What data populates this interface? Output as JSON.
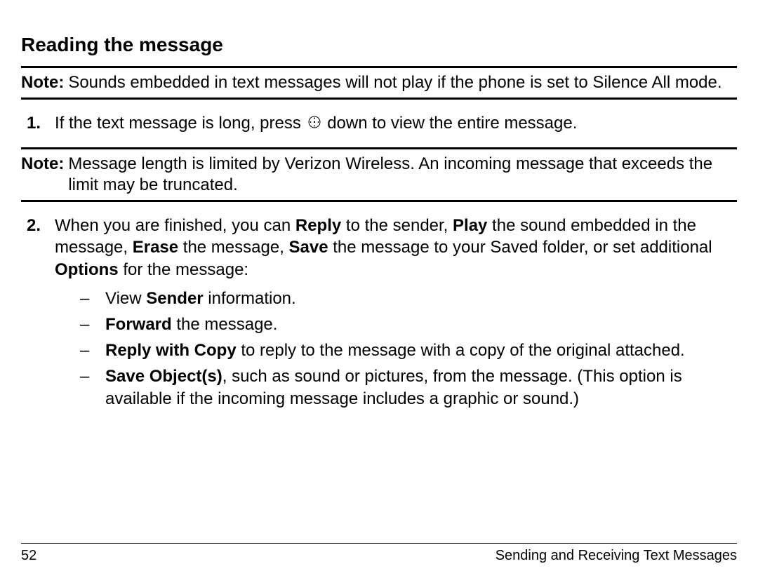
{
  "title": "Reading the message",
  "note1": {
    "label": "Note:",
    "text": "Sounds embedded in text messages will not play if the phone is set to Silence All mode."
  },
  "step1": {
    "num": "1.",
    "part1": "If the text message is long, press ",
    "part2": " down to view the entire message."
  },
  "note2": {
    "label": "Note:",
    "text": "Message length is limited by Verizon Wireless. An incoming message that exceeds the limit may be truncated."
  },
  "step2": {
    "num": "2.",
    "t1": "When you are finished, you can ",
    "b1": "Reply",
    "t2": " to the sender, ",
    "b2": "Play",
    "t3": " the sound embedded in the message, ",
    "b3": "Erase",
    "t4": " the message, ",
    "b4": "Save",
    "t5": " the message to your Saved folder, or set additional ",
    "b5": "Options",
    "t6": " for the message:"
  },
  "bullets": {
    "dash": "–",
    "a": {
      "t1": "View ",
      "b1": "Sender",
      "t2": " information."
    },
    "b": {
      "b1": "Forward",
      "t1": " the message."
    },
    "c": {
      "b1": "Reply with Copy",
      "t1": " to reply to the message with a copy of the original attached."
    },
    "d": {
      "b1": "Save Object(s)",
      "t1": ", such as sound or pictures, from the message. (This option is available if the incoming message includes a graphic or sound.)"
    }
  },
  "footer": {
    "page": "52",
    "section": "Sending and Receiving Text Messages"
  }
}
